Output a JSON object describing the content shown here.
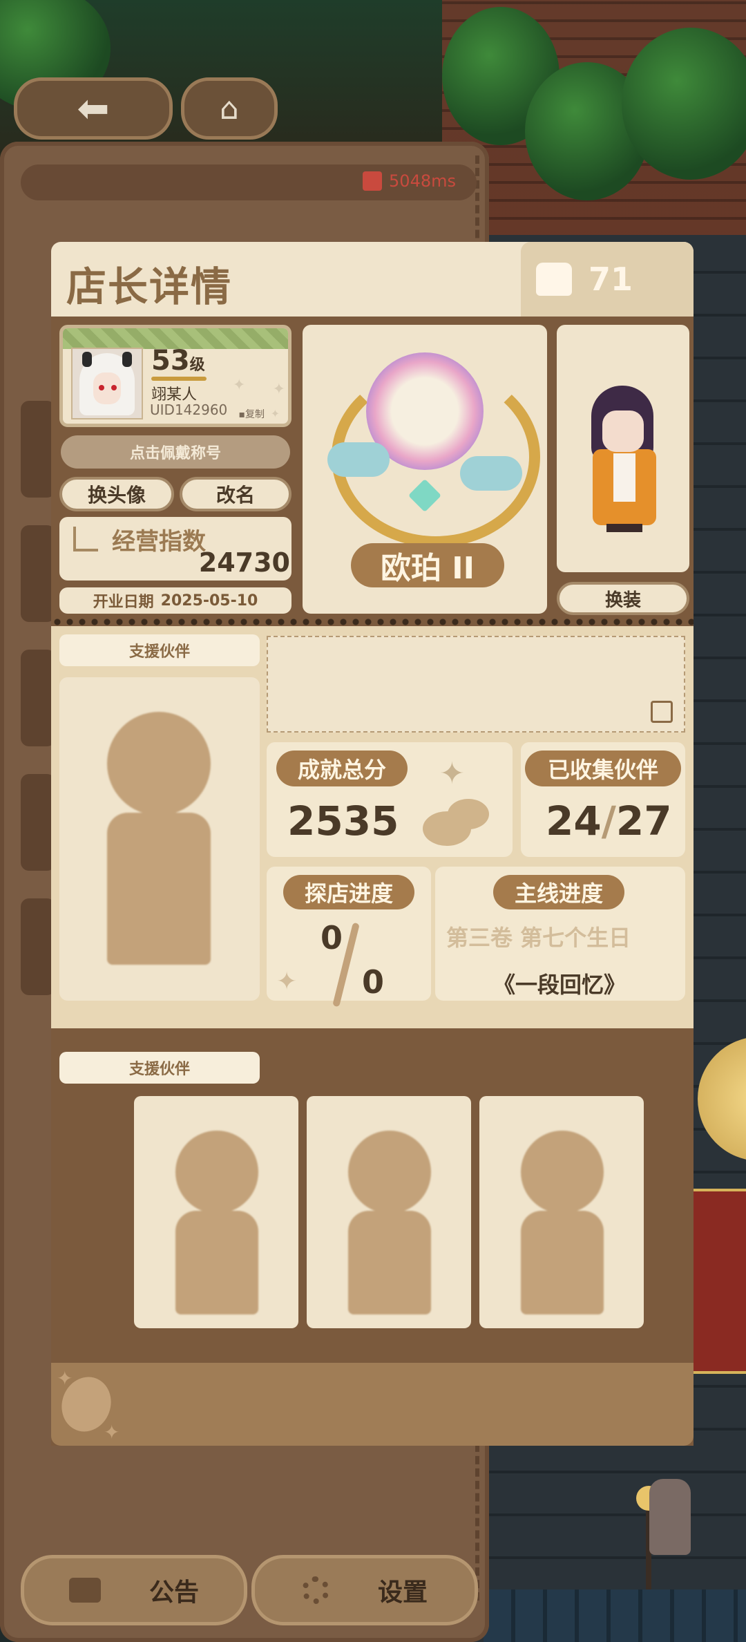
{
  "nav": {
    "back_icon": "arrow-left-icon",
    "home_icon": "home-icon"
  },
  "network": {
    "ping": "5048ms"
  },
  "dialog": {
    "title": "店长详情",
    "likes": "71"
  },
  "profile": {
    "level": "53",
    "level_suffix": "级",
    "name": "翊某人",
    "uid": "UID142960",
    "copy_label": "复制",
    "wear_title_label": "点击佩戴称号",
    "change_avatar_label": "换头像",
    "rename_label": "改名",
    "stat_label": "经营指数",
    "stat_value": "24730",
    "open_date_label": "开业日期",
    "open_date_value": "2025-05-10"
  },
  "rank": {
    "name": "欧珀 II"
  },
  "character": {
    "change_outfit_label": "换装"
  },
  "support": {
    "label_top": "支援伙伴",
    "label_bottom": "支援伙伴"
  },
  "stats": {
    "achievement_label": "成就总分",
    "achievement_value": "2535",
    "collected_label": "已收集伙伴",
    "collected_current": "24",
    "collected_sep": "/",
    "collected_total": "27",
    "explore_label": "探店进度",
    "explore_current": "0",
    "explore_total": "0",
    "main_label": "主线进度",
    "main_chapter": "第三卷 第七个生日",
    "main_title": "《一段回忆》"
  },
  "bottom_bar": {
    "notice_label": "公告",
    "settings_label": "设置"
  },
  "colors": {
    "panel": "#7b5a3d",
    "card": "#f0e4cc",
    "accent": "#a57b4c",
    "text_dark": "#4a3a28",
    "ping": "#c94a3e"
  }
}
